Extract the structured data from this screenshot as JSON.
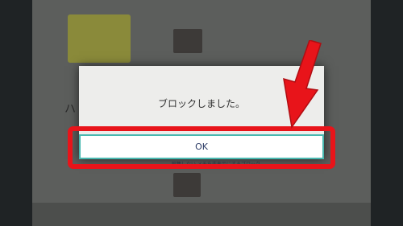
{
  "dialog": {
    "message": "ブロックしました。",
    "ok_label": "OK"
  },
  "background": {
    "partial_heading": "ハ",
    "partial_link": "編集しない   メモを非表示にするブロック"
  },
  "annotation": {
    "highlight_color": "#e8141a",
    "arrow": "red-arrow-icon"
  },
  "colors": {
    "ok_border": "#49b8b0",
    "ok_text": "#2c3b66"
  }
}
